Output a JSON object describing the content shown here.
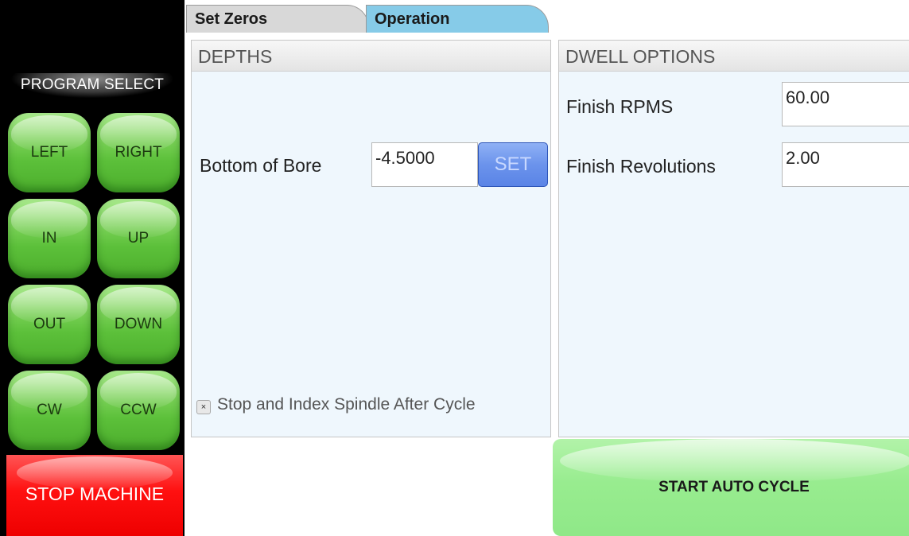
{
  "sidebar": {
    "title": "PROGRAM SELECT",
    "buttons": {
      "left": "LEFT",
      "right": "RIGHT",
      "in": "IN",
      "up": "UP",
      "out": "OUT",
      "down": "DOWN",
      "cw": "CW",
      "ccw": "CCW"
    },
    "stop_label": "STOP MACHINE"
  },
  "tabs": [
    {
      "label": "Set Zeros",
      "active": false
    },
    {
      "label": "Operation",
      "active": true
    }
  ],
  "depths": {
    "title": "DEPTHS",
    "bottom_of_bore_label": "Bottom of Bore",
    "bottom_of_bore_value": "-4.5000",
    "set_label": "SET",
    "checkbox_mark": "×",
    "checkbox_label": "Stop and Index Spindle After Cycle"
  },
  "dwell": {
    "title": "DWELL OPTIONS",
    "finish_rpms_label": "Finish RPMS",
    "finish_rpms_value": "60.00",
    "finish_revolutions_label": "Finish Revolutions",
    "finish_revolutions_value": "2.00"
  },
  "auto_cycle_label": "START AUTO CYCLE",
  "colors": {
    "jog_green": "#5cc03a",
    "stop_red": "#ff0000",
    "tab_active": "#86cbe8",
    "tab_inactive": "#d8d8d8",
    "set_blue": "#6b93ec",
    "auto_green": "#98ec8f"
  }
}
